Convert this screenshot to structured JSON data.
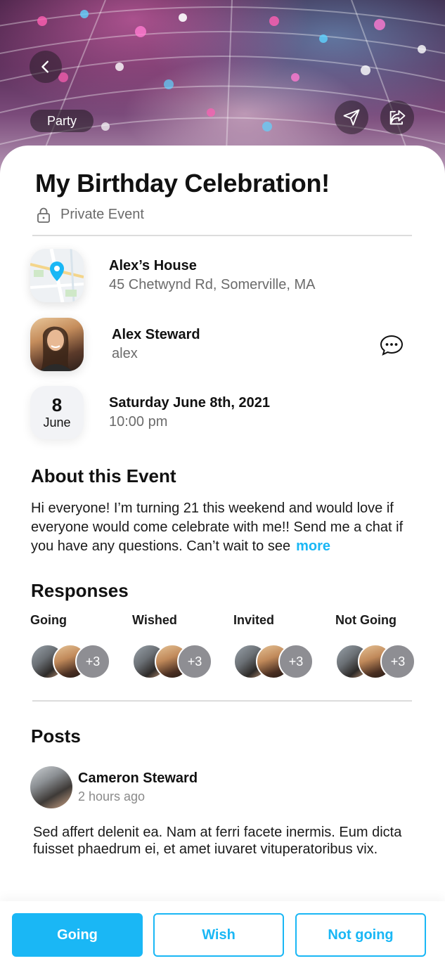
{
  "header": {
    "category_chip": "Party",
    "back_icon": "chevron-left-icon",
    "send_icon": "paper-plane-icon",
    "share_icon": "share-icon"
  },
  "event": {
    "title": "My Birthday Celebration!",
    "privacy_label": "Private Event",
    "privacy_icon": "lock-icon"
  },
  "location": {
    "name": "Alex’s House",
    "address": "45 Chetwynd Rd, Somerville, MA",
    "icon": "map-pin-icon"
  },
  "host": {
    "name": "Alex Steward",
    "username": "alex",
    "message_icon": "chat-bubble-icon"
  },
  "datetime": {
    "day": "8",
    "month": "June",
    "date_full": "Saturday June 8th, 2021",
    "time": "10:00 pm"
  },
  "about": {
    "heading": "About this Event",
    "text": "Hi everyone! I’m turning 21 this weekend and would love if everyone would come celebrate with me!! Send me a chat if you have any questions.  Can’t wait to see",
    "more_label": "more"
  },
  "responses": {
    "heading": "Responses",
    "groups": [
      {
        "label": "Going",
        "extra": "+3"
      },
      {
        "label": "Wished",
        "extra": "+3"
      },
      {
        "label": "Invited",
        "extra": "+3"
      },
      {
        "label": "Not Going",
        "extra": "+3"
      }
    ]
  },
  "posts": {
    "heading": "Posts",
    "items": [
      {
        "author": "Cameron Steward",
        "time": "2 hours ago",
        "body": "Sed affert delenit ea. Nam at ferri facete inermis. Eum dicta fuisset phaedrum ei, et amet iuvaret vituperatoribus vix."
      }
    ]
  },
  "actions": {
    "going": "Going",
    "wish": "Wish",
    "not_going": "Not going"
  },
  "colors": {
    "accent": "#1ab7f5",
    "text_primary": "#111111",
    "text_secondary": "#6b6b6b",
    "avatar_more_bg": "#8e8e93"
  }
}
